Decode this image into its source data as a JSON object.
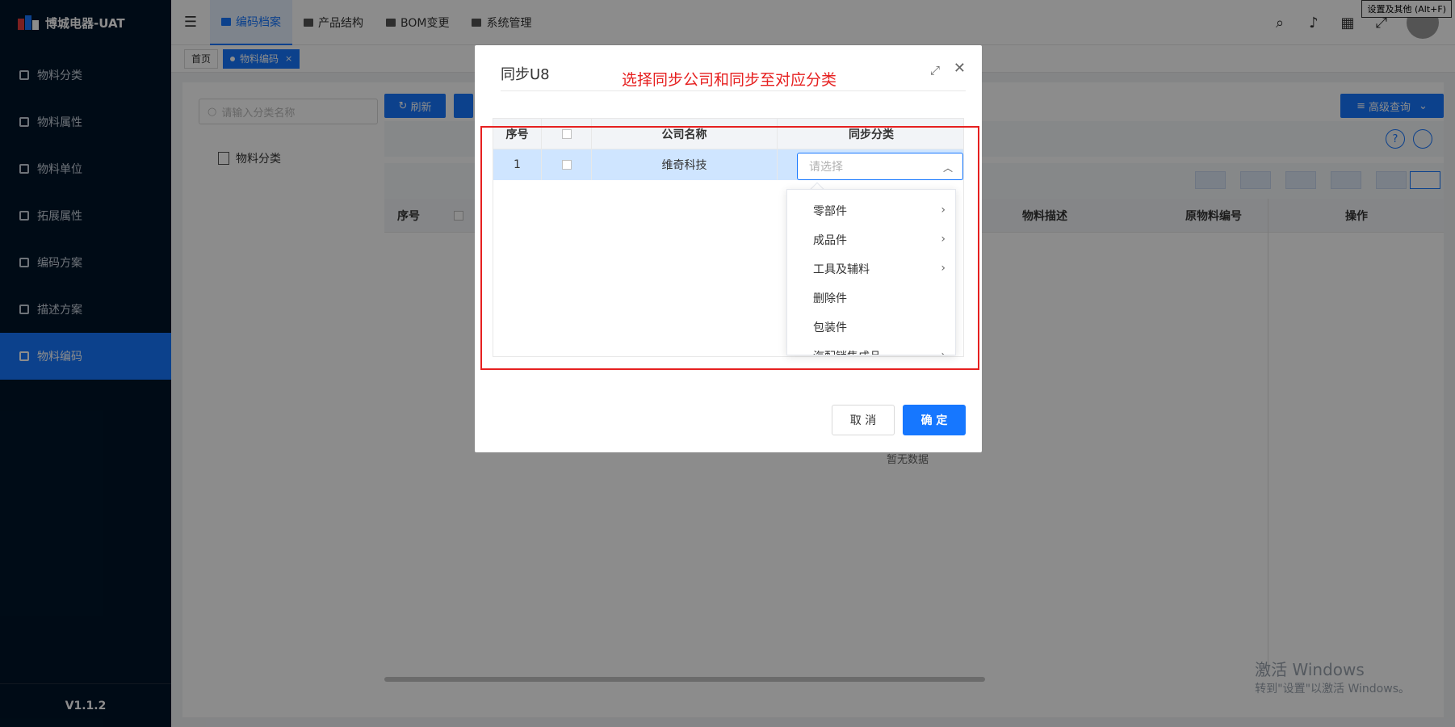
{
  "app": {
    "title": "博城电器-UAT",
    "version": "V1.1.2"
  },
  "sidebar": {
    "items": [
      {
        "label": "物料分类",
        "icon": "grid-icon"
      },
      {
        "label": "物料属性",
        "icon": "info-icon"
      },
      {
        "label": "物料单位",
        "icon": "edit-icon"
      },
      {
        "label": "拓展属性",
        "icon": "image-icon"
      },
      {
        "label": "编码方案",
        "icon": "doc-icon"
      },
      {
        "label": "描述方案",
        "icon": "doc-icon"
      },
      {
        "label": "物料编码",
        "icon": "doc-icon",
        "active": true
      }
    ]
  },
  "header": {
    "tabs": [
      {
        "label": "编码档案",
        "active": true
      },
      {
        "label": "产品结构"
      },
      {
        "label": "BOM变更"
      },
      {
        "label": "系统管理"
      }
    ],
    "tooltip": "设置及其他 (Alt+F)"
  },
  "tagsbar": {
    "home": "首页",
    "active_tag": "物料编码",
    "close": "×"
  },
  "leftpanel": {
    "search_placeholder": "请输入分类名称",
    "tree_root": "物料分类"
  },
  "rightpanel": {
    "refresh_label": "刷新",
    "advanced_label": "高级查询",
    "columns": [
      "序号",
      "物料描述",
      "原物料编号",
      "操作"
    ],
    "empty_text": "暂无数据"
  },
  "watermark": {
    "line1": "激活 Windows",
    "line2": "转到\"设置\"以激活 Windows。"
  },
  "modal": {
    "title": "同步U8",
    "annotation": "选择同步公司和同步至对应分类",
    "grid_headers": [
      "序号",
      "公司名称",
      "同步分类"
    ],
    "rows": [
      {
        "index": "1",
        "company": "维奇科技"
      }
    ],
    "select_placeholder": "请选择",
    "dropdown": [
      {
        "label": "零部件",
        "has_children": true
      },
      {
        "label": "成品件",
        "has_children": true
      },
      {
        "label": "工具及辅料",
        "has_children": true
      },
      {
        "label": "删除件",
        "has_children": false
      },
      {
        "label": "包装件",
        "has_children": false
      },
      {
        "label": "汽配销售成品",
        "has_children": true
      }
    ],
    "cancel_label": "取 消",
    "ok_label": "确 定"
  },
  "colors": {
    "primary": "#1677ff",
    "sidebar_bg": "#001529",
    "annotation": "#e62020"
  }
}
